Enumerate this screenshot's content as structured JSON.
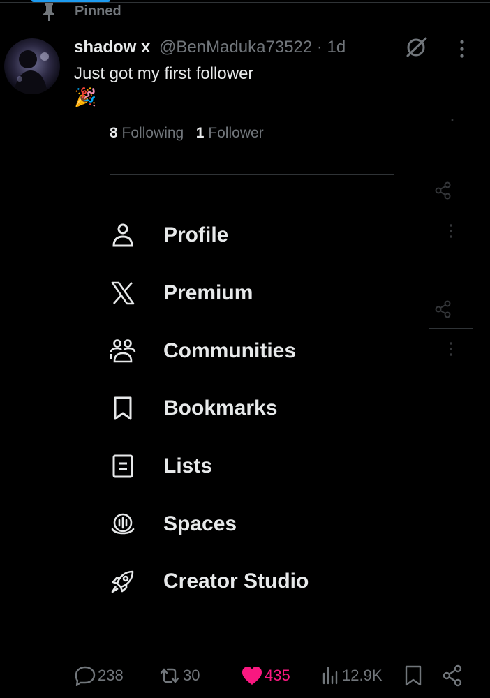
{
  "pinned": {
    "label": "Pinned"
  },
  "tweet": {
    "author_name": "shadow x",
    "handle_time": "@BenMaduka73522 · 1d",
    "text": "Just got my first follower",
    "emoji": "🎉"
  },
  "profile_stats": {
    "following_count": "8",
    "following_label": "Following",
    "followers_count": "1",
    "followers_label": "Follower"
  },
  "menu": {
    "items": [
      {
        "label": "Profile",
        "icon": "person-icon"
      },
      {
        "label": "Premium",
        "icon": "x-logo-icon"
      },
      {
        "label": "Communities",
        "icon": "communities-icon"
      },
      {
        "label": "Bookmarks",
        "icon": "bookmark-icon"
      },
      {
        "label": "Lists",
        "icon": "list-icon"
      },
      {
        "label": "Spaces",
        "icon": "spaces-icon"
      },
      {
        "label": "Creator Studio",
        "icon": "rocket-icon"
      }
    ]
  },
  "actions": {
    "replies": "238",
    "reposts": "30",
    "likes": "435",
    "views": "12.9K"
  },
  "colors": {
    "background": "#000000",
    "text": "#e7e9ea",
    "muted": "#71767b",
    "like": "#f91880",
    "accent": "#1d9bf0",
    "divider": "#2f3336"
  }
}
